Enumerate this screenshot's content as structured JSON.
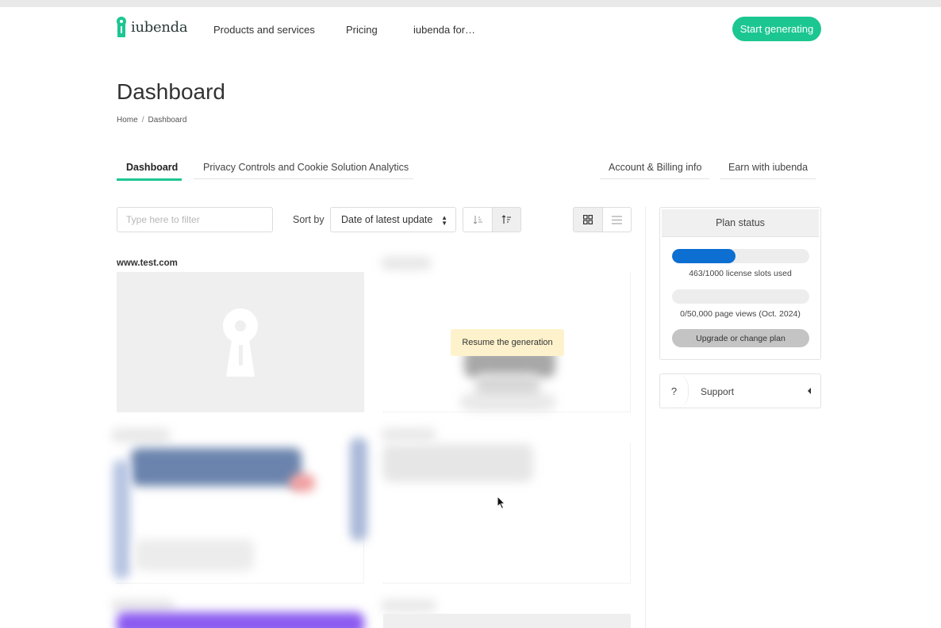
{
  "brand": {
    "name": "iubenda",
    "accent": "#1cc691"
  },
  "nav": [
    "Products and services",
    "Pricing",
    "iubenda for…"
  ],
  "cta_label": "Start generating",
  "page_title": "Dashboard",
  "breadcrumb": [
    "Home",
    "Dashboard"
  ],
  "tabs_left": [
    {
      "label": "Dashboard",
      "active": true
    },
    {
      "label": "Privacy Controls and Cookie Solution Analytics",
      "active": false
    }
  ],
  "tabs_right": [
    "Account & Billing info",
    "Earn with iubenda"
  ],
  "filter": {
    "placeholder": "Type here to filter",
    "value": ""
  },
  "sort": {
    "label": "Sort by",
    "selected": "Date of latest update"
  },
  "sort_direction_icons": [
    "sort-ascending-icon",
    "sort-descending-icon"
  ],
  "view_icons": [
    "grid-view-icon",
    "list-view-icon"
  ],
  "cards": [
    {
      "site": "www.test.com"
    }
  ],
  "tooltip": "Resume the generation",
  "plan": {
    "title": "Plan status",
    "license_fraction": 0.463,
    "license_text": "463/1000 license slots used",
    "pageviews_fraction": 0,
    "pageviews_text": "0/50,000 page views (Oct. 2024)",
    "button": "Upgrade or change plan",
    "bar_color": "#0c6fd1"
  },
  "support": {
    "icon": "?",
    "label": "Support"
  }
}
